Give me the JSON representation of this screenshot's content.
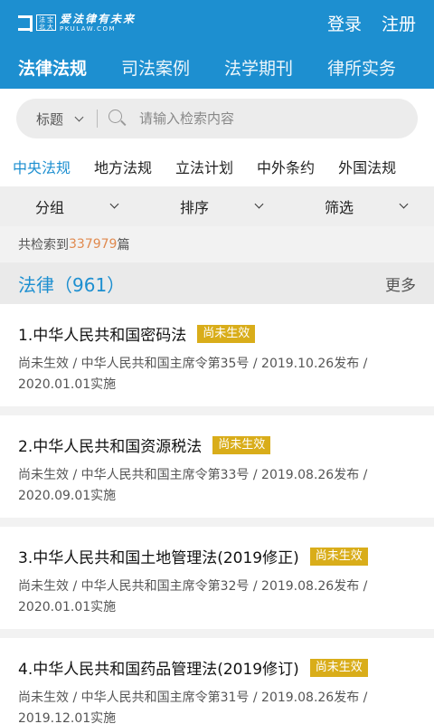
{
  "header": {
    "logo_box": [
      "法",
      "宝",
      "北",
      "大"
    ],
    "logo_slogan": "爱法律有未来",
    "logo_url": "PKULAW.COM",
    "login": "登录",
    "register": "注册"
  },
  "main_tabs": [
    {
      "label": "法律法规",
      "active": true
    },
    {
      "label": "司法案例"
    },
    {
      "label": "法学期刊"
    },
    {
      "label": "律所实务"
    }
  ],
  "search": {
    "field": "标题",
    "placeholder": "请输入检索内容"
  },
  "sub_tabs": [
    {
      "label": "中央法规",
      "active": true
    },
    {
      "label": "地方法规"
    },
    {
      "label": "立法计划"
    },
    {
      "label": "中外条约"
    },
    {
      "label": "外国法规"
    }
  ],
  "filters": [
    "分组",
    "排序",
    "筛选"
  ],
  "count": {
    "prefix": "共检索到",
    "number": "337979",
    "suffix": "篇"
  },
  "section": {
    "title": "法律（961）",
    "more": "更多"
  },
  "items": [
    {
      "title": "1.中华人民共和国密码法",
      "badge": "尚未生效",
      "meta": "尚未生效 / 中华人民共和国主席令第35号 / 2019.10.26发布 / 2020.01.01实施"
    },
    {
      "title": "2.中华人民共和国资源税法",
      "badge": "尚未生效",
      "meta": "尚未生效 / 中华人民共和国主席令第33号 / 2019.08.26发布 / 2020.09.01实施"
    },
    {
      "title": "3.中华人民共和国土地管理法(2019修正)",
      "badge": "尚未生效",
      "meta": "尚未生效 / 中华人民共和国主席令第32号 / 2019.08.26发布 / 2020.01.01实施"
    },
    {
      "title": "4.中华人民共和国药品管理法(2019修订)",
      "badge": "尚未生效",
      "meta": "尚未生效 / 中华人民共和国主席令第31号 / 2019.08.26发布 / 2019.12.01实施"
    }
  ],
  "colors": {
    "primary": "#1d8fd0",
    "badge": "#d9ad1a",
    "count_number": "#e08a4f"
  }
}
